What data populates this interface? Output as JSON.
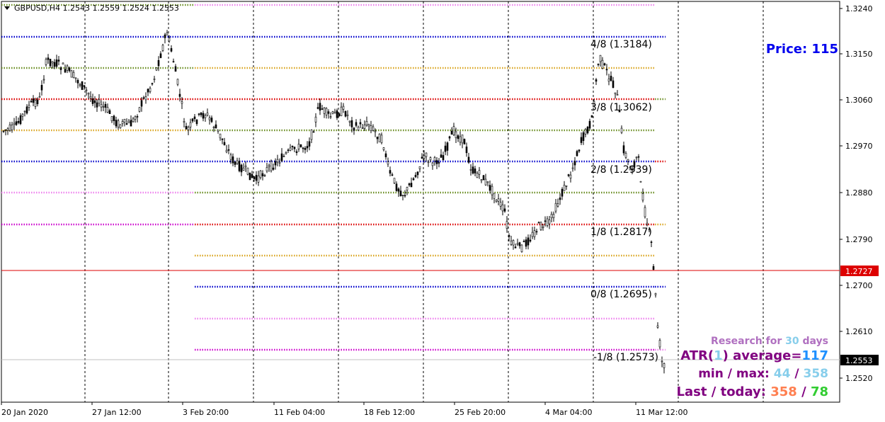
{
  "symbol_info": "GBPUSD,H4  1.2543 1.2559 1.2524 1.2553",
  "price_label": "Price: 115",
  "current_price": "1.2553",
  "red_line_price": "1.2727",
  "y_range": [
    1.246,
    1.3262
  ],
  "y_ticks": [
    "1.3240",
    "1.3150",
    "1.3060",
    "1.2970",
    "1.2880",
    "1.2790",
    "1.2700",
    "1.2610",
    "1.2520"
  ],
  "x_ticks": [
    "20 Jan 2020",
    "27 Jan 12:00",
    "3 Feb 20:00",
    "11 Feb 04:00",
    "18 Feb 12:00",
    "25 Feb 20:00",
    "4 Mar 04:00",
    "11 Mar 12:00"
  ],
  "murrey_labels": [
    {
      "text": "4/8 (1.3184)",
      "color": "#0000cc"
    },
    {
      "text": "3/8 (1.3062)",
      "color": "#6b8e23"
    },
    {
      "text": "2/8 (1.2939)",
      "color": "#dd0000"
    },
    {
      "text": "1/8 (1.2817)",
      "color": "#daa520"
    },
    {
      "text": "0/8 (1.2695)",
      "color": "#0000cc"
    },
    {
      "text": "-1/8 (1.2573)",
      "color": "#ee82ee"
    }
  ],
  "atr_panel": {
    "research_prefix": "Research for ",
    "research_days": "30",
    "research_suffix": " days",
    "atr_prefix": "ATR(",
    "atr_period": "1",
    "atr_mid": ") average=",
    "atr_value": "117",
    "minmax_prefix": "min / max: ",
    "min_value": "44",
    "minmax_sep": " / ",
    "max_value": "358",
    "last_prefix": "Last / today: ",
    "last_value": "358",
    "last_sep": " / ",
    "today_value": "78"
  },
  "colors": {
    "blue": "#0000cc",
    "olive": "#6b8e23",
    "red": "#dd0000",
    "orange": "#daa520",
    "violet": "#ee82ee",
    "magenta": "#cc00cc",
    "purple": "#800080",
    "skyblue": "#87ceeb",
    "coral": "#ff7f50",
    "green": "#32cd32",
    "research": "#b070c0"
  }
}
